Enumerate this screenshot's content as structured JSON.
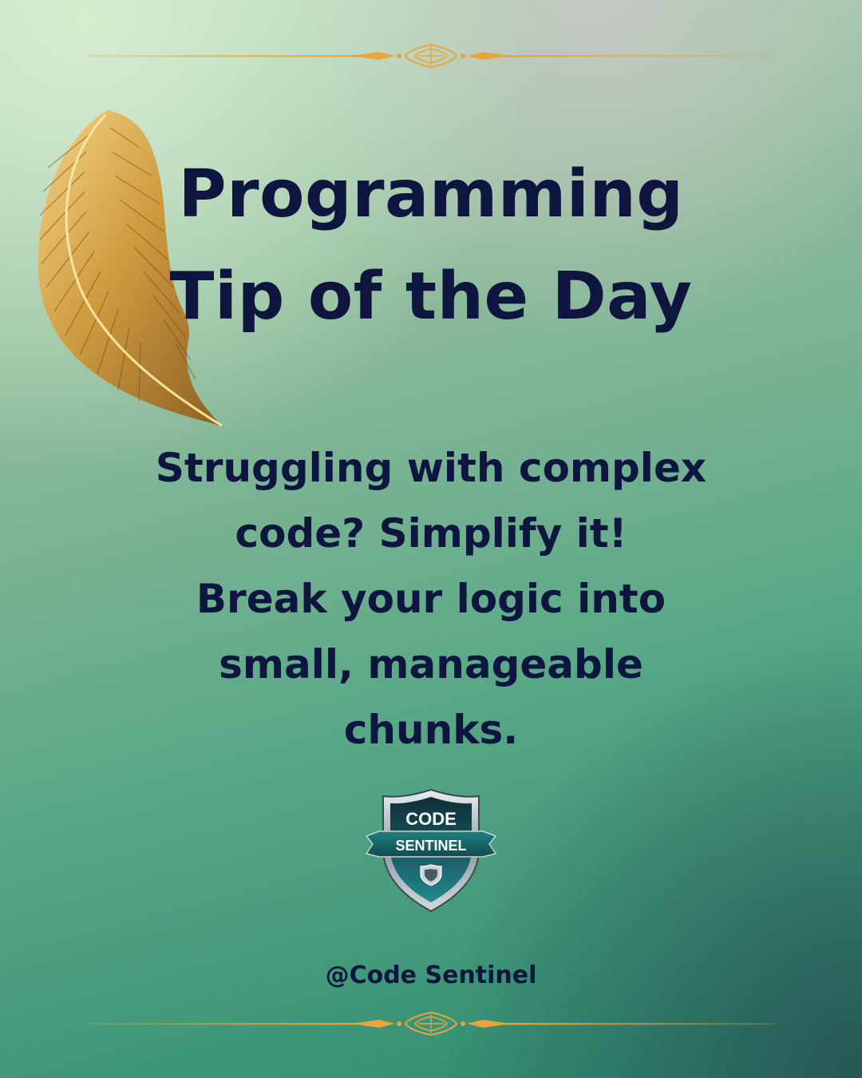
{
  "title_lines": [
    "Programming",
    "Tip of the Day"
  ],
  "tip_lines": [
    "Struggling with complex",
    "code? Simplify it!",
    "Break your logic into",
    "small, manageable",
    "chunks."
  ],
  "logo": {
    "line1": "CODE",
    "line2": "SENTINEL"
  },
  "handle": "@Code Sentinel",
  "icons": {
    "feather": "gold-feather-icon",
    "ornament": "gold-ornament-divider",
    "logo": "shield-logo"
  },
  "colors": {
    "text": "#0e1640",
    "gold": "#e0a33a",
    "shield_teal": "#1f8a8c",
    "shield_dark": "#0f2f38"
  }
}
